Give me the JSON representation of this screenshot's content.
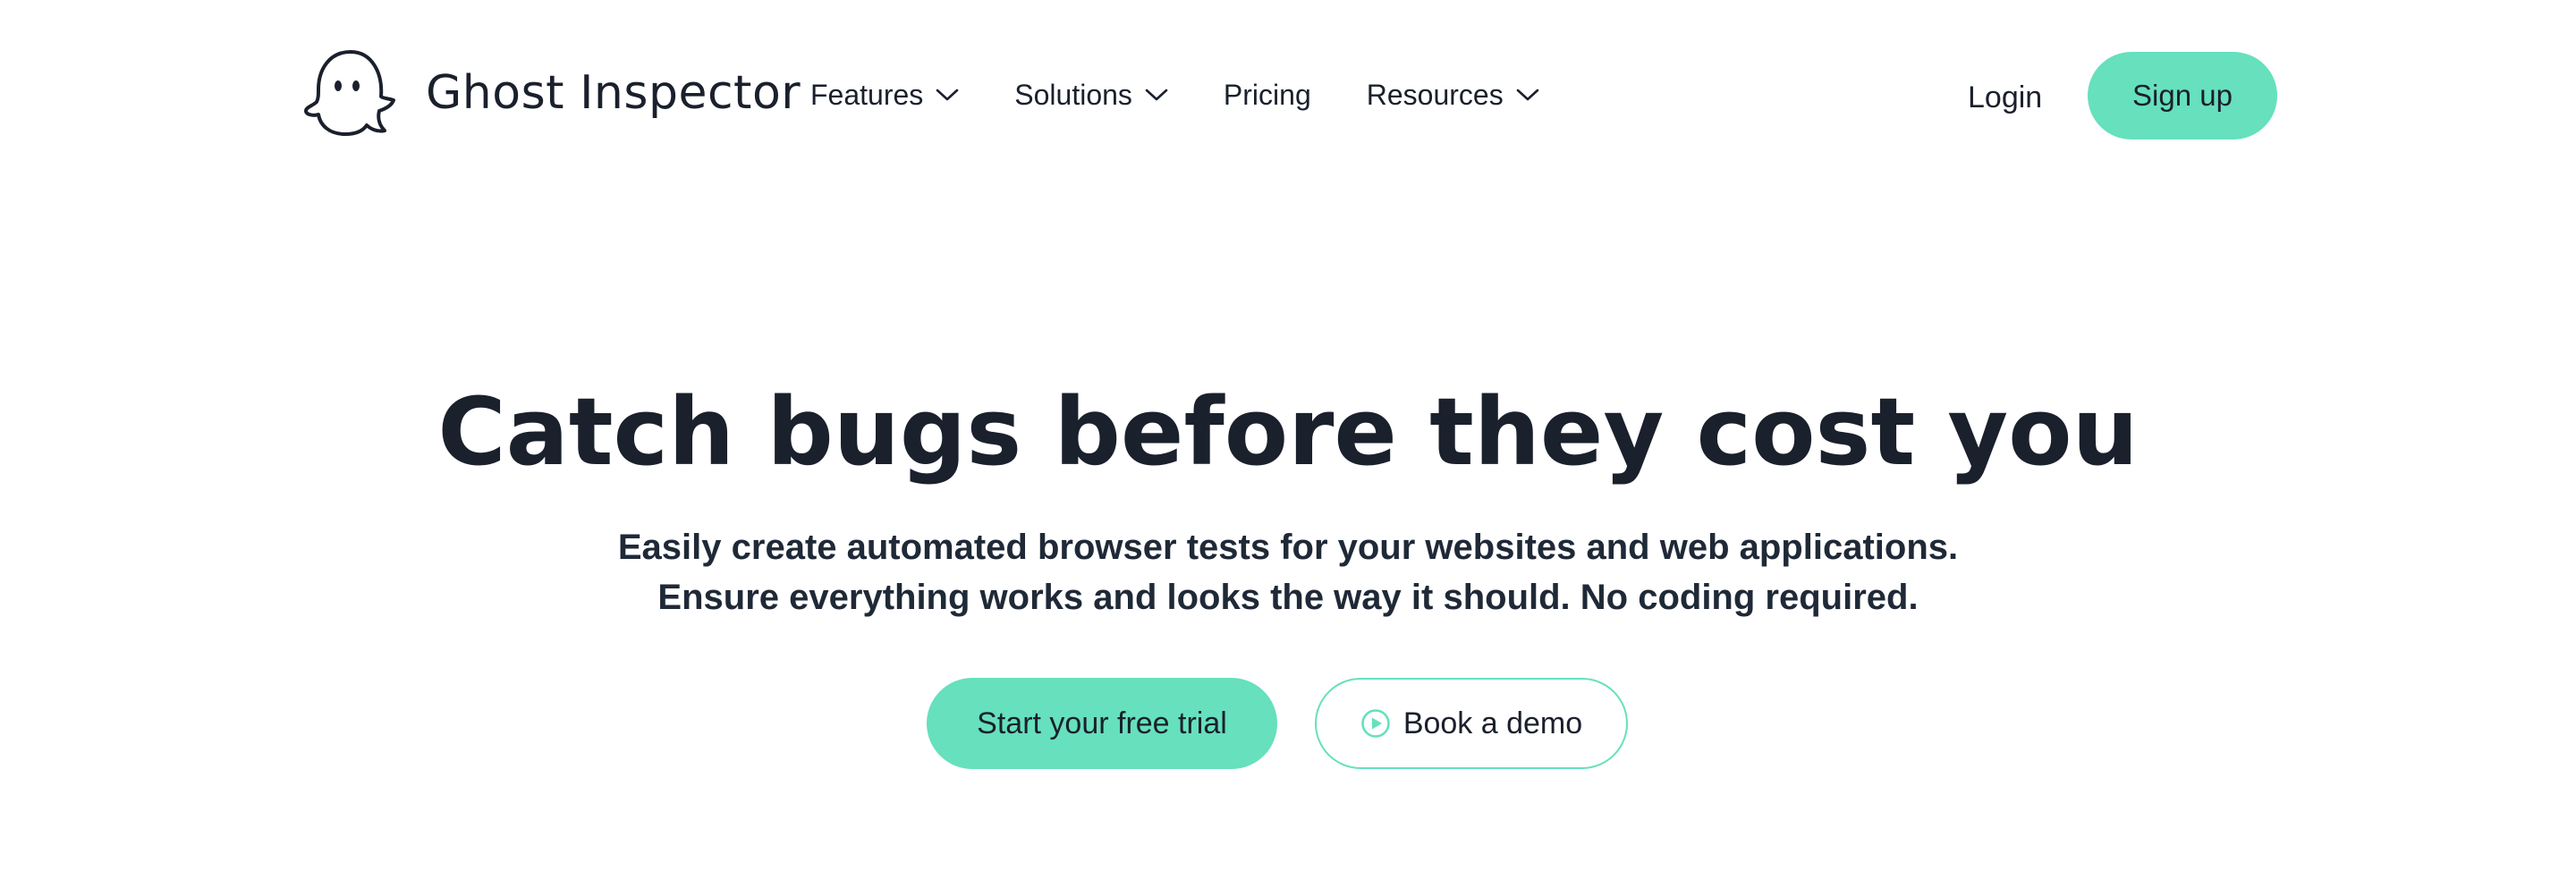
{
  "brand": {
    "name": "Ghost Inspector",
    "accent_color": "#66e0bd",
    "text_color": "#1a202c"
  },
  "nav": {
    "items": [
      {
        "label": "Features",
        "has_dropdown": true
      },
      {
        "label": "Solutions",
        "has_dropdown": true
      },
      {
        "label": "Pricing",
        "has_dropdown": false
      },
      {
        "label": "Resources",
        "has_dropdown": true
      }
    ],
    "login_label": "Login",
    "signup_label": "Sign up"
  },
  "hero": {
    "title": "Catch bugs before they cost you",
    "subtitle_line1": "Easily create automated browser tests for your websites and web applications.",
    "subtitle_line2": "Ensure everything works and looks the way it should. No coding required.",
    "primary_cta": "Start your free trial",
    "secondary_cta": "Book a demo",
    "secondary_cta_icon": "play-circle-icon"
  }
}
